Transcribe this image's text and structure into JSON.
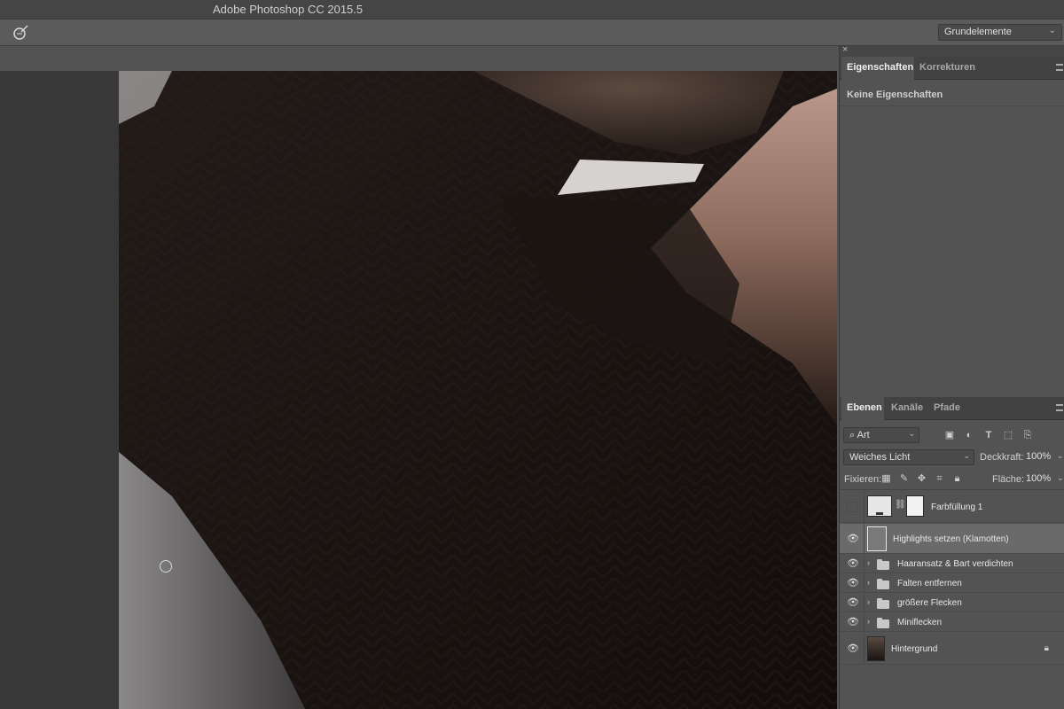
{
  "window": {
    "title": "Adobe Photoshop CC 2015.5"
  },
  "options_bar": {
    "tool_icon": "healing-brush-icon",
    "workspace": "Grundelemente"
  },
  "properties_panel": {
    "tabs": [
      {
        "label": "Eigenschaften",
        "active": true
      },
      {
        "label": "Korrekturen",
        "active": false
      }
    ],
    "empty_text": "Keine Eigenschaften"
  },
  "layers_panel": {
    "tabs": [
      {
        "label": "Ebenen",
        "active": true
      },
      {
        "label": "Kanäle",
        "active": false
      },
      {
        "label": "Pfade",
        "active": false
      }
    ],
    "filter_kind": "Art",
    "filter_icons": [
      "image-filter-icon",
      "adjustment-filter-icon",
      "type-filter-icon",
      "shape-filter-icon",
      "smart-object-filter-icon"
    ],
    "blend_mode": "Weiches Licht",
    "opacity_label": "Deckkraft:",
    "opacity_value": "100%",
    "lock_label": "Fixieren:",
    "lock_icons": [
      "lock-transparency-icon",
      "lock-pixels-icon",
      "lock-position-icon",
      "lock-artboard-icon",
      "lock-all-icon"
    ],
    "fill_label": "Fläche:",
    "fill_value": "100%",
    "layers": [
      {
        "name": "Farbfüllung 1",
        "type": "fill",
        "visible": false,
        "selected": false
      },
      {
        "name": "Highlights setzen (Klamotten)",
        "type": "pixel",
        "visible": true,
        "selected": true
      },
      {
        "name": "Haaransatz & Bart verdichten",
        "type": "group",
        "visible": true,
        "selected": false
      },
      {
        "name": "Falten entfernen",
        "type": "group",
        "visible": true,
        "selected": false
      },
      {
        "name": "größere Flecken",
        "type": "group",
        "visible": true,
        "selected": false
      },
      {
        "name": "Miniflecken",
        "type": "group",
        "visible": true,
        "selected": false
      },
      {
        "name": "Hintergrund",
        "type": "background",
        "visible": true,
        "selected": false,
        "locked": true
      }
    ]
  }
}
